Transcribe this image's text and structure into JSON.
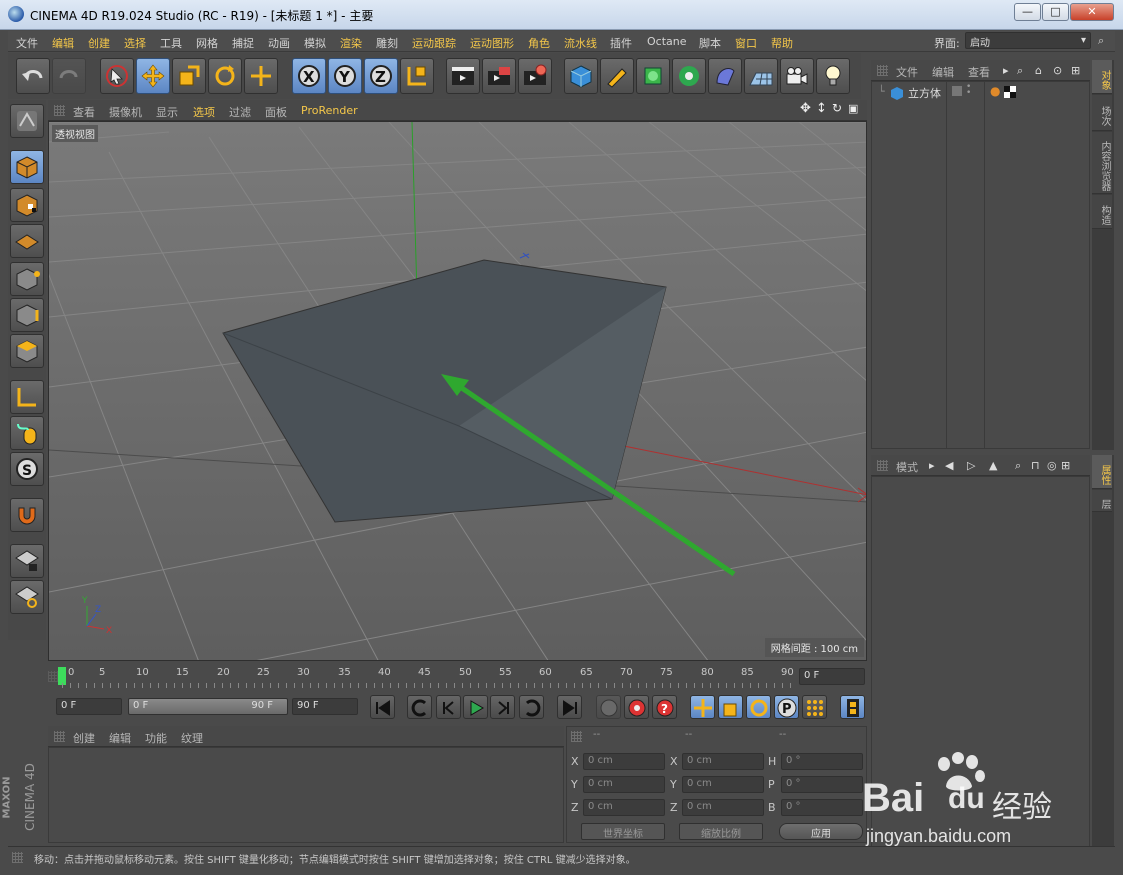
{
  "window": {
    "title": "CINEMA 4D R19.024 Studio (RC - R19) - [未标题 1 *] - 主要",
    "min": "—",
    "max": "□",
    "close": "✕"
  },
  "menubar": {
    "items": [
      "文件",
      "编辑",
      "创建",
      "选择",
      "工具",
      "网格",
      "捕捉",
      "动画",
      "模拟",
      "渲染",
      "雕刻",
      "运动跟踪",
      "运动图形",
      "角色",
      "流水线",
      "插件",
      "Octane",
      "脚本",
      "窗口",
      "帮助"
    ],
    "layout_label": "界面:",
    "layout_value": "启动"
  },
  "viewport": {
    "menu": [
      "查看",
      "摄像机",
      "显示",
      "选项",
      "过滤",
      "面板",
      "ProRender"
    ],
    "label": "透视视图",
    "grid_info": "网格间距 : 100 cm"
  },
  "timeline": {
    "ticks": [
      "0",
      "5",
      "10",
      "15",
      "20",
      "25",
      "30",
      "35",
      "40",
      "45",
      "50",
      "55",
      "60",
      "65",
      "70",
      "75",
      "80",
      "85",
      "90"
    ],
    "frame_display": "0 F",
    "start_frame": "0 F",
    "range_start": "0 F",
    "range_end": "90 F",
    "end_frame": "90 F"
  },
  "objects_panel": {
    "menu": [
      "文件",
      "编辑",
      "查看"
    ],
    "object_name": "立方体"
  },
  "attributes_panel": {
    "menu": [
      "模式"
    ]
  },
  "right_tabs": [
    "对象",
    "场次",
    "内容浏览器",
    "构造"
  ],
  "right_tabs2": [
    "属性",
    "层"
  ],
  "material_panel": {
    "menu": [
      "创建",
      "编辑",
      "功能",
      "纹理"
    ]
  },
  "coords_panel": {
    "headers": [
      "--",
      "--",
      "--"
    ],
    "rows": [
      {
        "a": "X",
        "av": "0 cm",
        "b": "X",
        "bv": "0 cm",
        "c": "H",
        "cv": "0 °"
      },
      {
        "a": "Y",
        "av": "0 cm",
        "b": "Y",
        "bv": "0 cm",
        "c": "P",
        "cv": "0 °"
      },
      {
        "a": "Z",
        "av": "0 cm",
        "b": "Z",
        "bv": "0 cm",
        "c": "B",
        "cv": "0 °"
      }
    ],
    "coord_system": "世界坐标",
    "scale_mode": "缩放比例",
    "apply": "应用"
  },
  "brand": {
    "line1": "MAXON",
    "line2": "CINEMA 4D"
  },
  "statusbar": {
    "text": "移动：点击并拖动鼠标移动元素。按住 SHIFT 键量化移动；节点编辑模式时按住 SHIFT 键增加选择对象；按住 CTRL 键减少选择对象。"
  },
  "watermark": {
    "brand": "Bai",
    "brand2": "du",
    "jingyan": "经验",
    "url": "jingyan.baidu.com"
  },
  "colors": {
    "accent": "#f4c74a",
    "select_blue": "#6f98d4",
    "bg": "#4a4a4a",
    "green_arrow": "#2fa82f"
  }
}
